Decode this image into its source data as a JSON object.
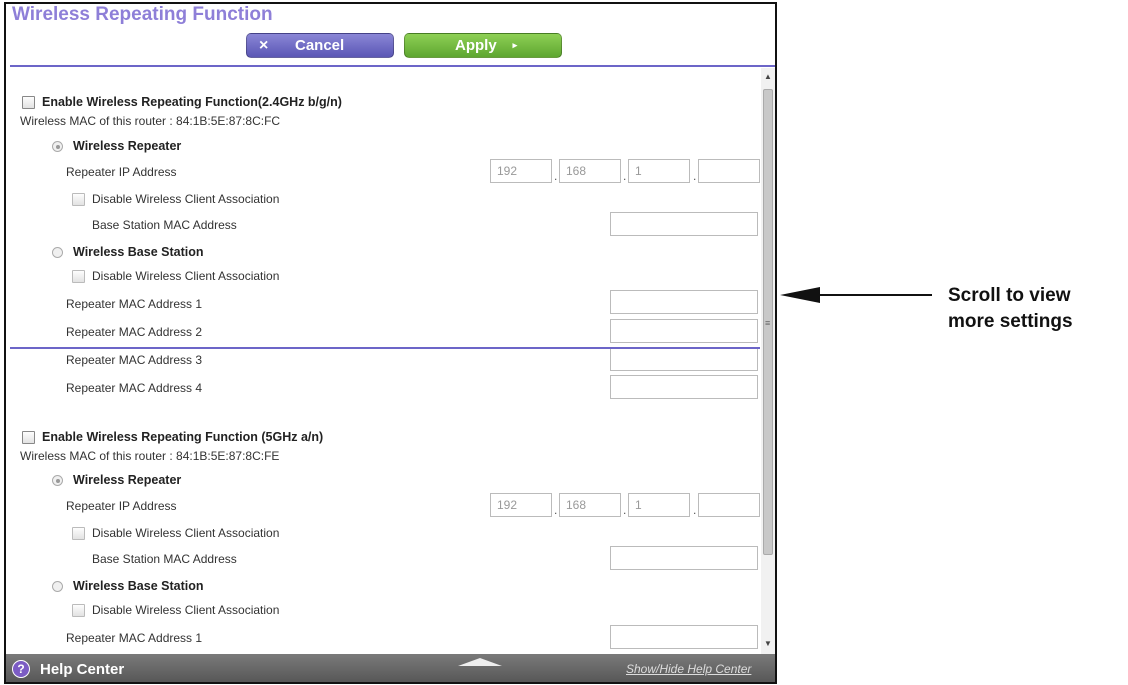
{
  "page": {
    "title": "Wireless Repeating Function"
  },
  "toolbar": {
    "cancel_icon": "×",
    "cancel_label": "Cancel",
    "apply_label": "Apply",
    "apply_arrow": "▸"
  },
  "section_24": {
    "enable_label": "Enable Wireless Repeating Function(2.4GHz b/g/n)",
    "mac_line": "Wireless MAC of this router : 84:1B:5E:87:8C:FC",
    "repeater_label": "Wireless Repeater",
    "repeater_ip_label": "Repeater IP Address",
    "ip": [
      "192",
      "168",
      "1",
      ""
    ],
    "disable_assoc_label": "Disable Wireless Client Association",
    "base_station_mac_label": "Base Station MAC Address",
    "base_station_label": "Wireless Base Station",
    "disable_assoc_label_2": "Disable Wireless Client Association",
    "repeater_macs": [
      "Repeater MAC Address 1",
      "Repeater MAC Address 2",
      "Repeater MAC Address 3",
      "Repeater MAC Address 4"
    ]
  },
  "section_5": {
    "enable_label": "Enable Wireless Repeating Function (5GHz a/n)",
    "mac_line": "Wireless MAC of this router : 84:1B:5E:87:8C:FE",
    "repeater_label": "Wireless Repeater",
    "repeater_ip_label": "Repeater IP Address",
    "ip": [
      "192",
      "168",
      "1",
      ""
    ],
    "disable_assoc_label": "Disable Wireless Client Association",
    "base_station_mac_label": "Base Station MAC Address",
    "base_station_label": "Wireless Base Station",
    "disable_assoc_label_2": "Disable Wireless Client Association",
    "repeater_mac_1": "Repeater MAC Address 1"
  },
  "help": {
    "label": "Help Center",
    "toggle": "Show/Hide Help Center"
  },
  "callout": {
    "line1": "Scroll to view",
    "line2": "more settings"
  },
  "icons": {
    "help": "question-circle-icon",
    "cancel": "close-icon",
    "apply": "play-arrow-icon"
  },
  "colors": {
    "title": "#8e7fd8",
    "cancel": "#6a66c4",
    "apply": "#6fb83b",
    "rule": "#6c65c8"
  }
}
